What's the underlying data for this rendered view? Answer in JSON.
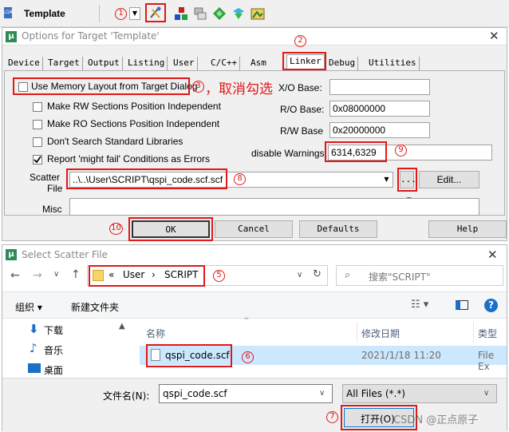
{
  "toolbar": {
    "project_name": "Template"
  },
  "options_dialog": {
    "title": "Options for Target 'Template'",
    "tabs": [
      "Device",
      "Target",
      "Output",
      "Listing",
      "User",
      "C/C++",
      "Asm",
      "Linker",
      "Debug",
      "Utilities"
    ],
    "checkboxes": [
      {
        "label": "Use Memory Layout from Target Dialog",
        "checked": false
      },
      {
        "label": "Make RW Sections Position Independent",
        "checked": false
      },
      {
        "label": "Make RO Sections Position Independent",
        "checked": false
      },
      {
        "label": "Don't Search Standard Libraries",
        "checked": false
      },
      {
        "label": "Report 'might fail' Conditions as Errors",
        "checked": true
      }
    ],
    "xo_base_label": "X/O Base:",
    "ro_base_label": "R/O Base:",
    "ro_base_value": "0x08000000",
    "rw_base_label": "R/W Base",
    "rw_base_value": "0x20000000",
    "disable_warnings_label": "disable Warnings:",
    "disable_warnings_value": "6314,6329",
    "scatter_file_label_1": "Scatter",
    "scatter_file_label_2": "File",
    "scatter_file_value": "..\\..\\User\\SCRIPT\\qspi_code.scf.scf",
    "browse_label": "...",
    "edit_label": "Edit...",
    "misc_label": "Misc",
    "buttons": {
      "ok": "OK",
      "cancel": "Cancel",
      "defaults": "Defaults",
      "help": "Help"
    }
  },
  "annotations": {
    "n1": "1",
    "n2": "2",
    "n3": "3",
    "n3_note": "，取消勾选",
    "n4": "4",
    "n5": "5",
    "n6": "6",
    "n7": "7",
    "n8": "8",
    "n9": "9",
    "n10": "10"
  },
  "select_dialog": {
    "title": "Select Scatter File",
    "breadcrumb": [
      "«",
      "User",
      "SCRIPT"
    ],
    "search_placeholder": "搜索\"SCRIPT\"",
    "organize_label": "组织 ▾",
    "new_folder_label": "新建文件夹",
    "sidebar": [
      "下载",
      "音乐",
      "桌面"
    ],
    "columns": {
      "name": "名称",
      "date": "修改日期",
      "type": "类型"
    },
    "file": {
      "name": "qspi_code.scf",
      "date": "2021/1/18 11:20",
      "type": "File Ex"
    },
    "filename_label": "文件名(N):",
    "filename_value": "qspi_code.scf",
    "filter_value": "All Files (*.*)",
    "open_label": "打开(O)",
    "watermark": "CSDN @正点原子"
  },
  "colors": {
    "annotation_red": "#e01818",
    "check_green": "#1e8c2e"
  }
}
